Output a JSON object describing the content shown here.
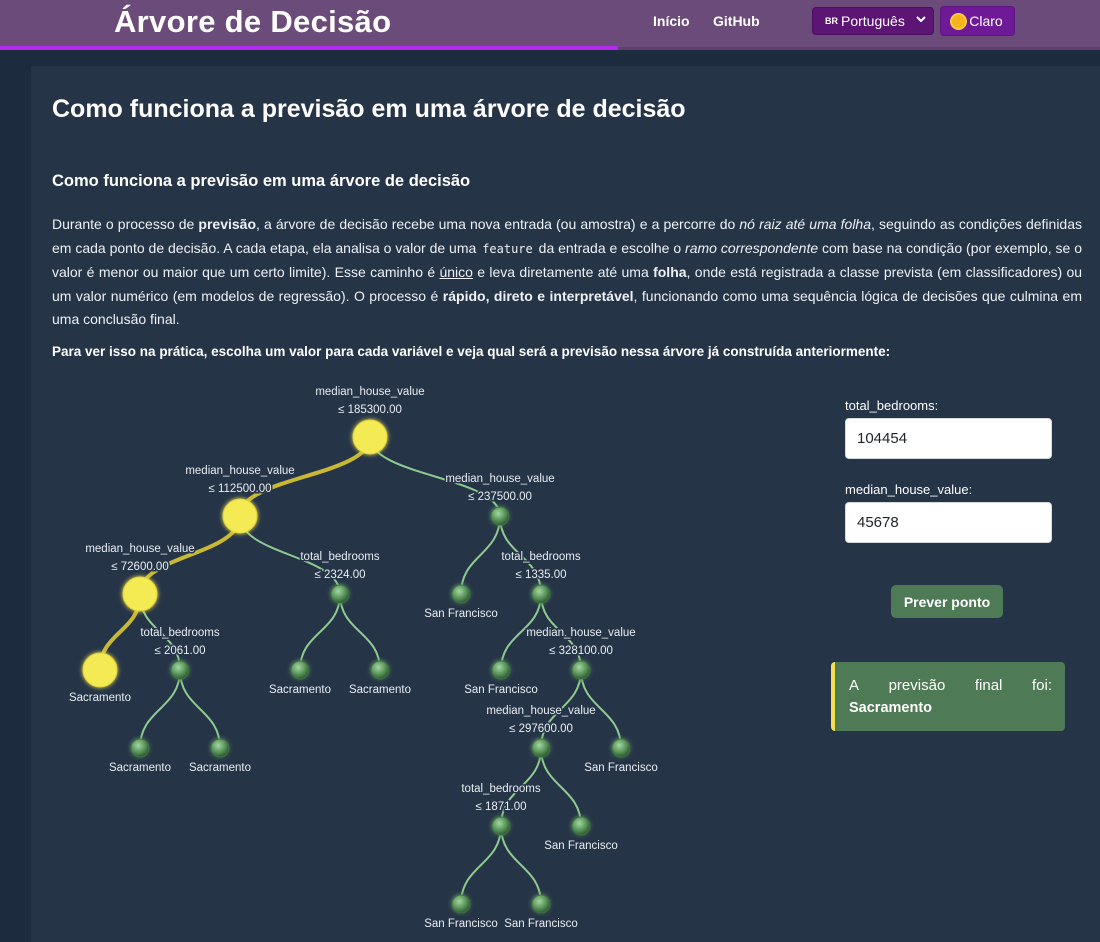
{
  "header": {
    "brand": "Árvore de Decisão",
    "nav": [
      "Início",
      "GitHub"
    ],
    "language": {
      "flag": "BR",
      "label": "Português"
    },
    "theme_label": "Claro"
  },
  "article": {
    "title": "Como funciona a previsão em uma árvore de decisão",
    "subtitle": "Como funciona a previsão em uma árvore de decisão",
    "p_1": "Durante o processo de ",
    "p_b1": "previsão",
    "p_2": ", a árvore de decisão recebe uma nova entrada (ou amostra) e a percorre do ",
    "p_i1": "nó raiz até uma folha",
    "p_3": ", seguindo as condições definidas em cada ponto de decisão. A cada etapa, ela analisa o valor de uma ",
    "p_code": "feature",
    "p_4": " da entrada e escolhe o ",
    "p_i2": "ramo correspondente",
    "p_5": " com base na condição (por exemplo, se o valor é menor ou maior que um certo limite). Esse caminho é ",
    "p_u1": "único",
    "p_6": " e leva diretamente até uma ",
    "p_b2": "folha",
    "p_7": ", onde está registrada a classe prevista (em classificadores) ou um valor numérico (em modelos de regressão). O processo é ",
    "p_b3": "rápido, direto e interpretável",
    "p_8": ", funcionando como uma sequência lógica de decisões que culmina em uma conclusão final.",
    "prompt": "Para ver isso na prática, escolha um valor para cada variável e veja qual será a previsão nessa árvore já construída anteriormente:"
  },
  "form": {
    "field_1": {
      "label": "total_bedrooms:",
      "value": "104454"
    },
    "field_2": {
      "label": "median_house_value:",
      "value": "45678"
    },
    "button": "Prever ponto",
    "result_label_words": [
      "A",
      "previsão",
      "final",
      "foi:"
    ],
    "result_value": "Sacramento"
  },
  "tree": {
    "colors": {
      "path": "#c8b834",
      "edge": "#8ecb8e",
      "highlight": "#f4ea52",
      "node": "#5f9a5f"
    },
    "nodes": [
      {
        "id": "n0",
        "feature": "median_house_value",
        "threshold": "≤ 185300.00",
        "active": true
      },
      {
        "id": "n1",
        "parent": "n0",
        "feature": "median_house_value",
        "threshold": "≤ 112500.00",
        "active": true
      },
      {
        "id": "n2",
        "parent": "n0",
        "feature": "median_house_value",
        "threshold": "≤ 237500.00"
      },
      {
        "id": "n3",
        "parent": "n1",
        "feature": "median_house_value",
        "threshold": "≤ 72600.00",
        "active": true
      },
      {
        "id": "n4",
        "parent": "n1",
        "feature": "total_bedrooms",
        "threshold": "≤ 2324.00"
      },
      {
        "id": "n5",
        "parent": "n2",
        "leaf": "San Francisco"
      },
      {
        "id": "n6",
        "parent": "n2",
        "feature": "total_bedrooms",
        "threshold": "≤ 1335.00"
      },
      {
        "id": "n7",
        "parent": "n3",
        "leaf": "Sacramento",
        "active": true
      },
      {
        "id": "n8",
        "parent": "n3",
        "feature": "total_bedrooms",
        "threshold": "≤ 2061.00"
      },
      {
        "id": "n9",
        "parent": "n4",
        "leaf": "Sacramento"
      },
      {
        "id": "n10",
        "parent": "n4",
        "leaf": "Sacramento"
      },
      {
        "id": "n11",
        "parent": "n6",
        "leaf": "San Francisco"
      },
      {
        "id": "n12",
        "parent": "n6",
        "feature": "median_house_value",
        "threshold": "≤ 328100.00"
      },
      {
        "id": "n13",
        "parent": "n8",
        "leaf": "Sacramento"
      },
      {
        "id": "n14",
        "parent": "n8",
        "leaf": "Sacramento"
      },
      {
        "id": "n15",
        "parent": "n12",
        "feature": "median_house_value",
        "threshold": "≤ 297600.00"
      },
      {
        "id": "n16",
        "parent": "n12",
        "leaf": "San Francisco"
      },
      {
        "id": "n17",
        "parent": "n15",
        "feature": "total_bedrooms",
        "threshold": "≤ 1871.00"
      },
      {
        "id": "n18",
        "parent": "n15",
        "leaf": "San Francisco"
      },
      {
        "id": "n19",
        "parent": "n17",
        "leaf": "San Francisco"
      },
      {
        "id": "n20",
        "parent": "n17",
        "leaf": "San Francisco"
      }
    ]
  }
}
